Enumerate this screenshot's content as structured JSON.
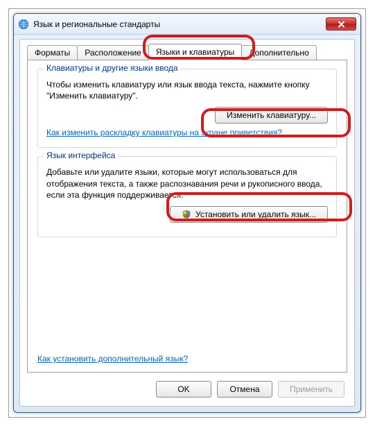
{
  "window": {
    "title": "Язык и региональные стандарты"
  },
  "tabs": {
    "t0": "Форматы",
    "t1": "Расположение",
    "t2": "Языки и клавиатуры",
    "t3": "Дополнительно"
  },
  "group1": {
    "title": "Клавиатуры и другие языки ввода",
    "desc": "Чтобы изменить клавиатуру или язык ввода текста, нажмите кнопку \"Изменить клавиатуру\".",
    "button": "Изменить клавиатуру...",
    "link": "Как изменить раскладку клавиатуры на экране приветствия?"
  },
  "group2": {
    "title": "Язык интерфейса",
    "desc": "Добавьте или удалите языки, которые могут использоваться для отображения текста, а также распознавания речи и рукописного ввода, если эта функция поддерживается.",
    "button": "Установить или удалить язык..."
  },
  "bottom_link": "Как установить дополнительный язык?",
  "buttons": {
    "ok": "OK",
    "cancel": "Отмена",
    "apply": "Применить"
  }
}
